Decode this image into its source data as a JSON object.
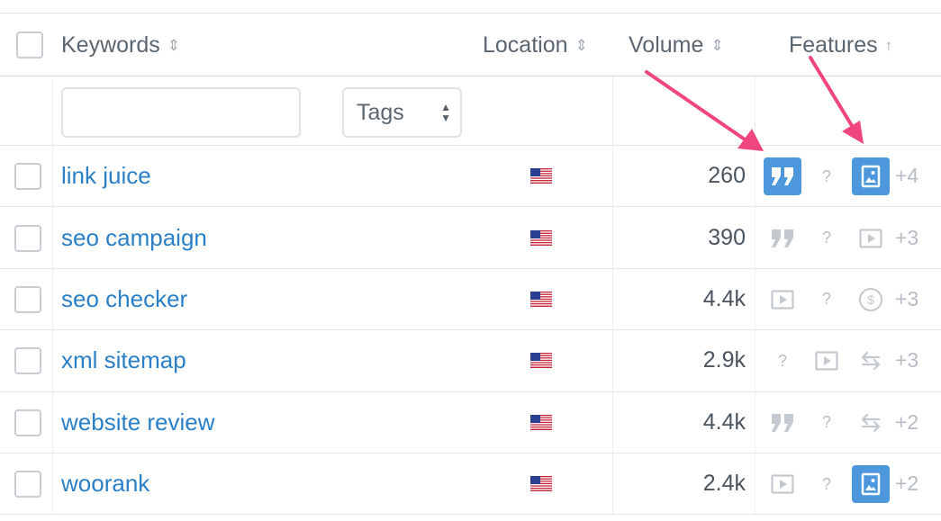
{
  "header": {
    "keywords": "Keywords",
    "location": "Location",
    "volume": "Volume",
    "features": "Features",
    "sort_icon": "⇕",
    "sort_asc_icon": "↑"
  },
  "filters": {
    "keyword_input_value": "",
    "keyword_input_placeholder": "",
    "tags_label": "Tags"
  },
  "rows": [
    {
      "keyword": "link juice",
      "location": "US",
      "volume": "260",
      "more": "+4"
    },
    {
      "keyword": "seo campaign",
      "location": "US",
      "volume": "390",
      "more": "+3"
    },
    {
      "keyword": "seo checker",
      "location": "US",
      "volume": "4.4k",
      "more": "+3"
    },
    {
      "keyword": "xml sitemap",
      "location": "US",
      "volume": "2.9k",
      "more": "+3"
    },
    {
      "keyword": "website review",
      "location": "US",
      "volume": "4.4k",
      "more": "+2"
    },
    {
      "keyword": "woorank",
      "location": "US",
      "volume": "2.4k",
      "more": "+2"
    }
  ],
  "row_features": [
    [
      "quote-icon-active",
      "question-icon",
      "image-icon-active"
    ],
    [
      "quote-icon",
      "question-icon",
      "video-icon"
    ],
    [
      "video-icon",
      "question-icon",
      "dollar-icon"
    ],
    [
      "question-icon",
      "video-icon",
      "swap-icon"
    ],
    [
      "quote-icon",
      "question-icon",
      "swap-icon"
    ],
    [
      "video-icon",
      "question-icon",
      "image-icon-active"
    ]
  ],
  "colors": {
    "link": "#2a7fc7",
    "active_feature": "#4d98dc",
    "annotation_arrow": "#f0457f"
  }
}
